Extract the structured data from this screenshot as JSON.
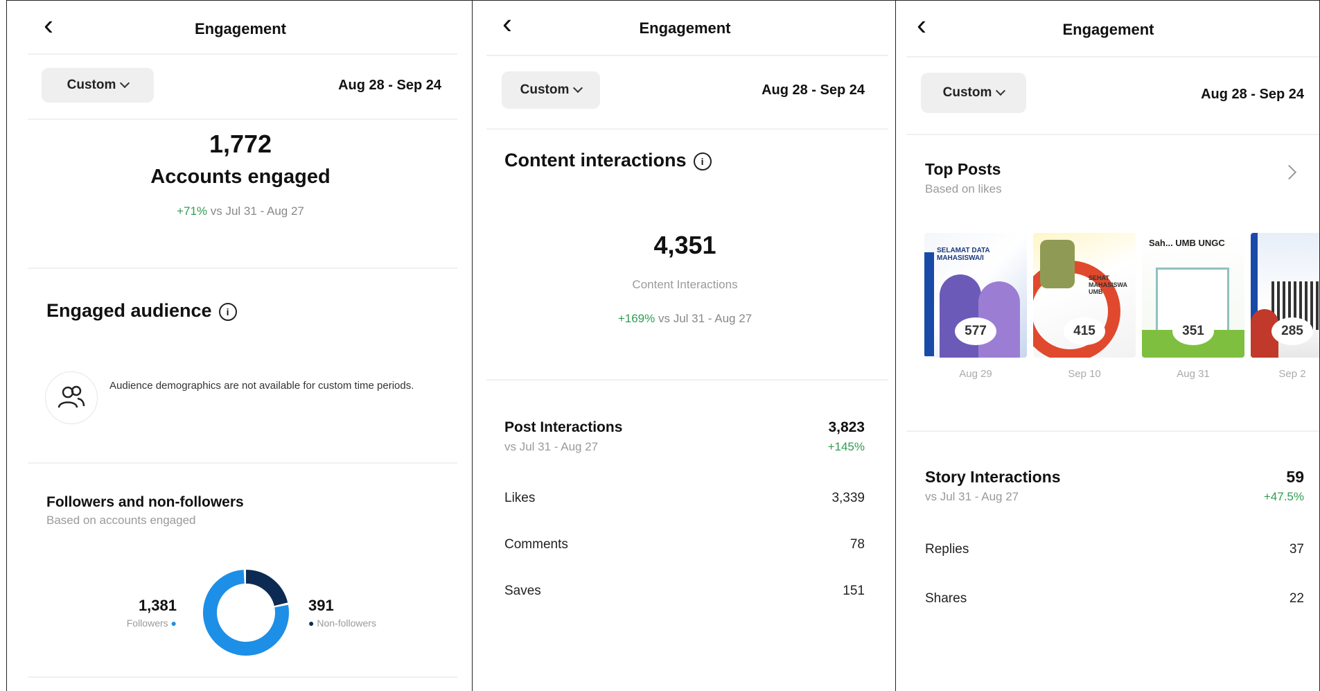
{
  "panel1": {
    "title": "Engagement",
    "filter_label": "Custom",
    "date_range": "Aug 28 - Sep 24",
    "accounts_value": "1,772",
    "accounts_label": "Accounts engaged",
    "accounts_change": "+71%",
    "accounts_compare": " vs Jul 31 - Aug 27",
    "audience_title": "Engaged audience",
    "audience_notice": "Audience demographics are not available for custom time periods.",
    "followers_title": "Followers and non-followers",
    "followers_subtitle": "Based on accounts engaged",
    "followers_value": "1,381",
    "followers_label": "Followers",
    "nonfollowers_value": "391",
    "nonfollowers_label": "Non-followers",
    "followers_fraction": 0.779,
    "colors": {
      "followers": "#1d8fe6",
      "nonfollowers": "#0d2b52"
    }
  },
  "panel2": {
    "title": "Engagement",
    "filter_label": "Custom",
    "date_range": "Aug 28 - Sep 24",
    "section_title": "Content interactions",
    "total_value": "4,351",
    "total_label": "Content Interactions",
    "total_change": "+169%",
    "total_compare": " vs Jul 31 - Aug 27",
    "post_title": "Post Interactions",
    "post_compare": "vs Jul 31 - Aug 27",
    "post_value": "3,823",
    "post_change": "+145%",
    "rows": [
      {
        "label": "Likes",
        "value": "3,339"
      },
      {
        "label": "Comments",
        "value": "78"
      },
      {
        "label": "Saves",
        "value": "151"
      }
    ]
  },
  "panel3": {
    "title": "Engagement",
    "filter_label": "Custom",
    "date_range": "Aug 28 - Sep 24",
    "top_posts_title": "Top Posts",
    "top_posts_subtitle": "Based on likes",
    "posts": [
      {
        "count": "577",
        "date": "Aug 29",
        "caption": "SELAMAT DATA MAHASISWA/I"
      },
      {
        "count": "415",
        "date": "Sep 10",
        "caption": "SEHAT MAHASISWA UMB"
      },
      {
        "count": "351",
        "date": "Aug 31",
        "caption": "Sah... UMB UNGC"
      },
      {
        "count": "285",
        "date": "Sep 2",
        "caption": ""
      }
    ],
    "story_title": "Story Interactions",
    "story_compare": "vs Jul 31 - Aug 27",
    "story_value": "59",
    "story_change": "+47.5%",
    "rows": [
      {
        "label": "Replies",
        "value": "37"
      },
      {
        "label": "Shares",
        "value": "22"
      }
    ]
  }
}
